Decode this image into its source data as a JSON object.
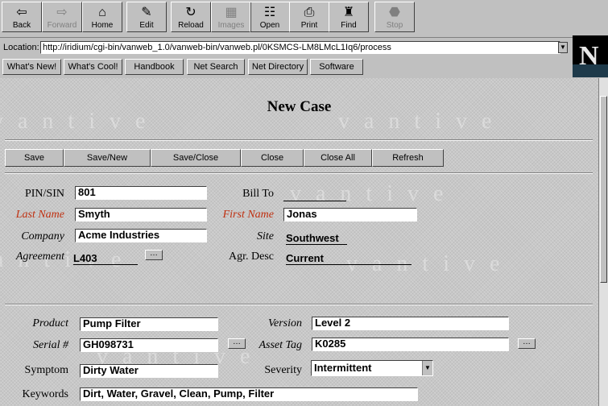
{
  "toolbar": {
    "buttons": [
      {
        "label": "Back",
        "icon": "back-arrow-icon",
        "glyph": "⇦",
        "enabled": true
      },
      {
        "label": "Forward",
        "icon": "forward-arrow-icon",
        "glyph": "⇨",
        "enabled": false
      },
      {
        "label": "Home",
        "icon": "home-icon",
        "glyph": "⌂",
        "enabled": true
      },
      {
        "label": "Edit",
        "icon": "pencil-icon",
        "glyph": "✎",
        "enabled": true
      },
      {
        "label": "Reload",
        "icon": "reload-icon",
        "glyph": "↻",
        "enabled": true
      },
      {
        "label": "Images",
        "icon": "images-icon",
        "glyph": "▦",
        "enabled": false
      },
      {
        "label": "Open",
        "icon": "open-icon",
        "glyph": "☷",
        "enabled": true
      },
      {
        "label": "Print",
        "icon": "printer-icon",
        "glyph": "⎙",
        "enabled": true
      },
      {
        "label": "Find",
        "icon": "binoculars-icon",
        "glyph": "♜",
        "enabled": true
      },
      {
        "label": "Stop",
        "icon": "stop-icon",
        "glyph": "⬣",
        "enabled": false
      }
    ]
  },
  "location": {
    "label": "Location:",
    "url": "http://iridium/cgi-bin/vanweb_1.0/vanweb-bin/vanweb.pl/0KSMCS-LM8LMcL1Iq6/process"
  },
  "directory_buttons": [
    "What's New!",
    "What's Cool!",
    "Handbook",
    "Net Search",
    "Net Directory",
    "Software"
  ],
  "logo": {
    "letter": "N"
  },
  "page": {
    "title": "New Case",
    "watermark": "vantive"
  },
  "actions": [
    "Save",
    "Save/New",
    "Save/Close",
    "Close",
    "Close All",
    "Refresh"
  ],
  "form": {
    "pin_sin": {
      "label": "PIN/SIN",
      "value": "801"
    },
    "bill_to": {
      "label": "Bill To",
      "value": ""
    },
    "last_name": {
      "label": "Last Name",
      "value": "Smyth"
    },
    "first_name": {
      "label": "First Name",
      "value": "Jonas"
    },
    "company": {
      "label": "Company",
      "value": "Acme Industries"
    },
    "site": {
      "label": "Site",
      "value": "Southwest"
    },
    "agreement": {
      "label": "Agreement",
      "value": "L403"
    },
    "agr_desc": {
      "label": "Agr. Desc",
      "value": "Current"
    },
    "product": {
      "label": "Product",
      "value": "Pump Filter"
    },
    "version": {
      "label": "Version",
      "value": "Level 2"
    },
    "serial": {
      "label": "Serial #",
      "value": "GH098731"
    },
    "asset_tag": {
      "label": "Asset Tag",
      "value": "K0285"
    },
    "symptom": {
      "label": "Symptom",
      "value": "Dirty Water"
    },
    "severity": {
      "label": "Severity",
      "value": "Intermittent"
    },
    "keywords": {
      "label": "Keywords",
      "value": "Dirt, Water, Gravel, Clean, Pump, Filter"
    }
  },
  "lookup_glyph": "…",
  "colors": {
    "required_label": "#c03010"
  }
}
